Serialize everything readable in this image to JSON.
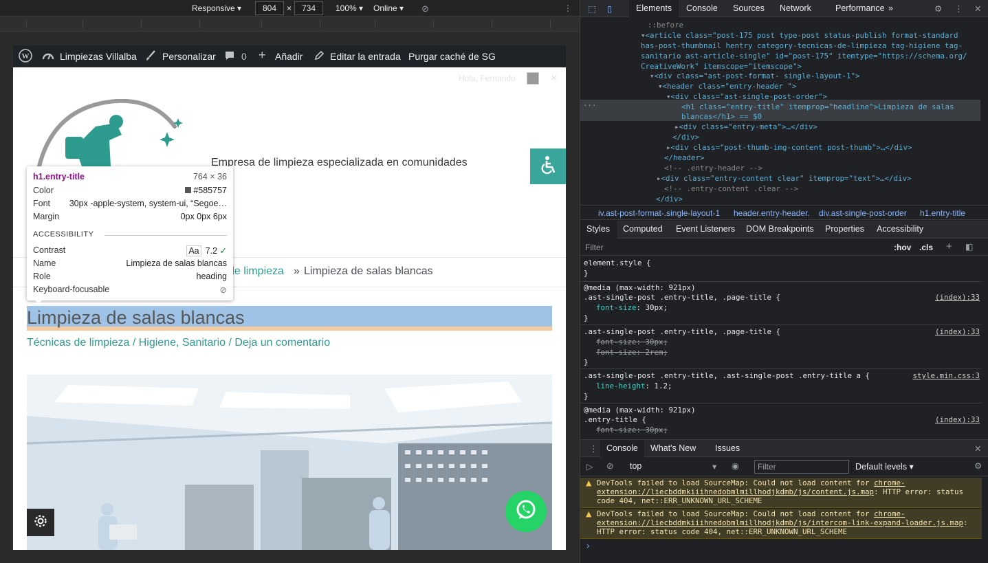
{
  "device_toolbar": {
    "mode": "Responsive",
    "width": "804",
    "times": "×",
    "height": "734",
    "zoom": "100%",
    "network": "Online"
  },
  "wp_admin_bar": {
    "site_name": "Limpiezas Villalba",
    "customize": "Personalizar",
    "comments_count": "0",
    "add_new": "Añadir",
    "edit_post": "Editar la entrada",
    "purge_cache": "Purgar caché de SG"
  },
  "site": {
    "greeting": "Hola, Fernando",
    "tagline": "Empresa de limpieza especializada en comunidades",
    "breadcrumb_link": "de limpieza",
    "breadcrumb_sep": "»",
    "breadcrumb_current": "Limpieza de salas blancas",
    "title": "Limpieza de salas blancas",
    "meta": "Técnicas de limpieza / Higiene, Sanitario / Deja un comentario"
  },
  "inspect_tooltip": {
    "selector": "h1.entry-title",
    "size": "764 × 36",
    "color_label": "Color",
    "color_value": "#585757",
    "font_label": "Font",
    "font_value": "30px -apple-system, system-ui, “Segoe…",
    "margin_label": "Margin",
    "margin_value": "0px 0px 6px",
    "accessibility_heading": "ACCESSIBILITY",
    "contrast_label": "Contrast",
    "contrast_badge": "Aa",
    "contrast_value": "7.2",
    "name_label": "Name",
    "name_value": "Limpieza de salas blancas",
    "role_label": "Role",
    "role_value": "heading",
    "keyboard_label": "Keyboard-focusable"
  },
  "devtools": {
    "tabs": [
      "Elements",
      "Console",
      "Sources",
      "Network",
      "Performance"
    ],
    "more": "»",
    "dom_lines": [
      "::before",
      "<article class=\"post-175 post type-post status-publish format-standard",
      "has-post-thumbnail hentry category-tecnicas-de-limpieza tag-higiene tag-",
      "sanitario ast-article-single\" id=\"post-175\" itemtype=\"https://schema.org/",
      "CreativeWork\" itemscope=\"itemscope\">",
      "<div class=\"ast-post-format- single-layout-1\">",
      "<header class=\"entry-header \">",
      "<div class=\"ast-single-post-order\">",
      "<h1 class=\"entry-title\" itemprop=\"headline\">Limpieza de salas",
      "blancas</h1> == $0",
      "<div class=\"entry-meta\">…</div>",
      "</div>",
      "<div class=\"post-thumb-img-content post-thumb\">…</div>",
      "</header>",
      "<!-- .entry-header -->",
      "<div class=\"entry-content clear\" itemprop=\"text\">…</div>",
      "<!-- .entry-content .clear -->",
      "</div>"
    ],
    "breadcrumbs": [
      "iv.ast-post-format-.single-layout-1",
      "header.entry-header.",
      "div.ast-single-post-order",
      "h1.entry-title"
    ],
    "styles_tabs": [
      "Styles",
      "Computed",
      "Event Listeners",
      "DOM Breakpoints",
      "Properties",
      "Accessibility"
    ],
    "filter_placeholder": "Filter",
    "hov": ":hov",
    "cls": ".cls",
    "rules": [
      {
        "selector": "element.style {",
        "close": "}"
      },
      {
        "media": "@media (max-width: 921px)",
        "selector": ".ast-single-post .entry-title, .page-title {",
        "source": "(index):33",
        "props": [
          {
            "name": "font-size",
            "value": "30px;",
            "struck": false
          }
        ],
        "close": "}"
      },
      {
        "selector": ".ast-single-post .entry-title, .page-title {",
        "source": "(index):33",
        "props": [
          {
            "name": "font-size",
            "value": "30px;",
            "struck": true
          },
          {
            "name": "font-size",
            "value": "2rem;",
            "struck": true
          }
        ],
        "close": "}"
      },
      {
        "selector": ".ast-single-post .entry-title, .ast-single-post .entry-title a {",
        "source": "style.min.css:3",
        "props": [
          {
            "name": "line-height",
            "value": "1.2;",
            "struck": false
          }
        ],
        "close": "}"
      },
      {
        "media": "@media (max-width: 921px)",
        "selector": ".entry-title {",
        "source": "(index):33",
        "props": [
          {
            "name": "font-size",
            "value": "30px;",
            "struck": true
          }
        ]
      }
    ],
    "drawer_tabs": [
      "Console",
      "What's New",
      "Issues"
    ],
    "context": "top",
    "console_filter": "Filter",
    "levels": "Default levels",
    "messages": [
      {
        "pre": "DevTools failed to load SourceMap: Could not load content for ",
        "link": "chrome-extension://liecbddmkiiihnedobmlmillhodjkdmb/js/content.js.map",
        "post": ": HTTP error: status code 404, net::ERR_UNKNOWN_URL_SCHEME"
      },
      {
        "pre": "DevTools failed to load SourceMap: Could not load content for ",
        "link": "chrome-extension://liecbddmkiiihnedobmlmillhodjkdmb/js/intercom-link-expand-loader.js.map",
        "post": ": HTTP error: status code 404, net::ERR_UNKNOWN_URL_SCHEME"
      }
    ],
    "prompt": "›"
  },
  "colors": {
    "accent_teal": "#2d9c8f",
    "title_color": "#585757",
    "whatsapp": "#25d366",
    "selection_blue": "#9fc3e6"
  }
}
